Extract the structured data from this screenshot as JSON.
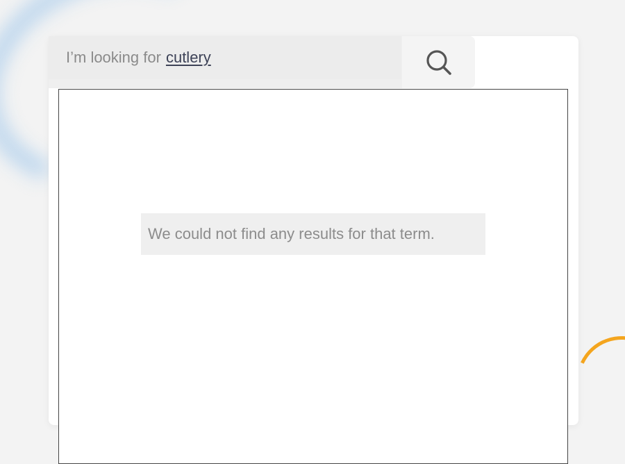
{
  "search": {
    "prefix": "I’m looking for",
    "term": "cutlery",
    "button_icon": "search-icon"
  },
  "results": {
    "empty_message": "We could not find any results for that term."
  },
  "colors": {
    "background": "#f3f3f3",
    "card": "#ffffff",
    "search_field": "#ececec",
    "search_term": "#3d4257",
    "muted_text": "#8c8c8c",
    "decor_blue": "#a9ccec",
    "decor_orange": "#f4a51e"
  }
}
